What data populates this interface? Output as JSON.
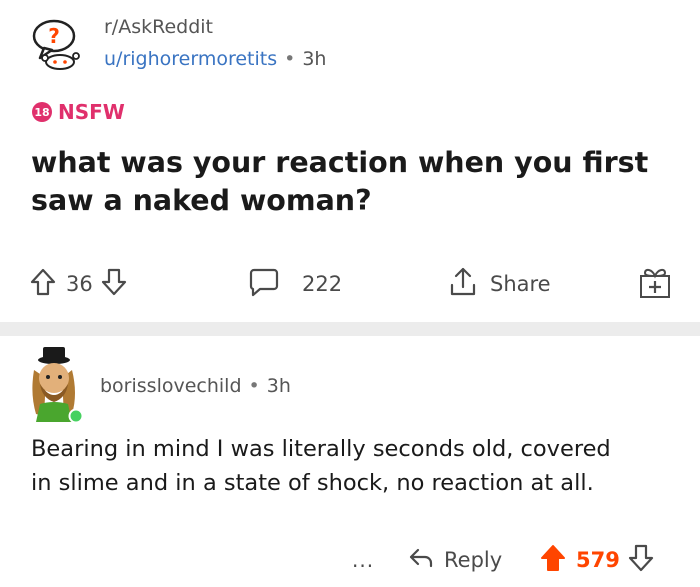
{
  "post": {
    "subreddit": "r/AskReddit",
    "user": "u/righorermoretits",
    "separator": "•",
    "time": "3h",
    "nsfw_badge": "18",
    "nsfw_label": "NSFW",
    "title": "what was your reaction when you first saw a naked woman?",
    "upvotes": "36",
    "comments": "222",
    "share_label": "Share"
  },
  "comment": {
    "author": "borisslovechild",
    "separator": "•",
    "time": "3h",
    "body": "Bearing in mind I was literally seconds old, covered in slime and in a state of shock, no reaction at all.",
    "more_label": "...",
    "reply_label": "Reply",
    "score": "579"
  },
  "colors": {
    "accent_upvote": "#ff4500",
    "nsfw": "#e0306c",
    "user_link": "#3a74c2",
    "online": "#46d160"
  },
  "icons": [
    "subreddit-icon",
    "upvote-icon",
    "downvote-icon",
    "comment-icon",
    "share-icon",
    "award-icon",
    "avatar",
    "reply-icon",
    "upvoted-icon"
  ]
}
